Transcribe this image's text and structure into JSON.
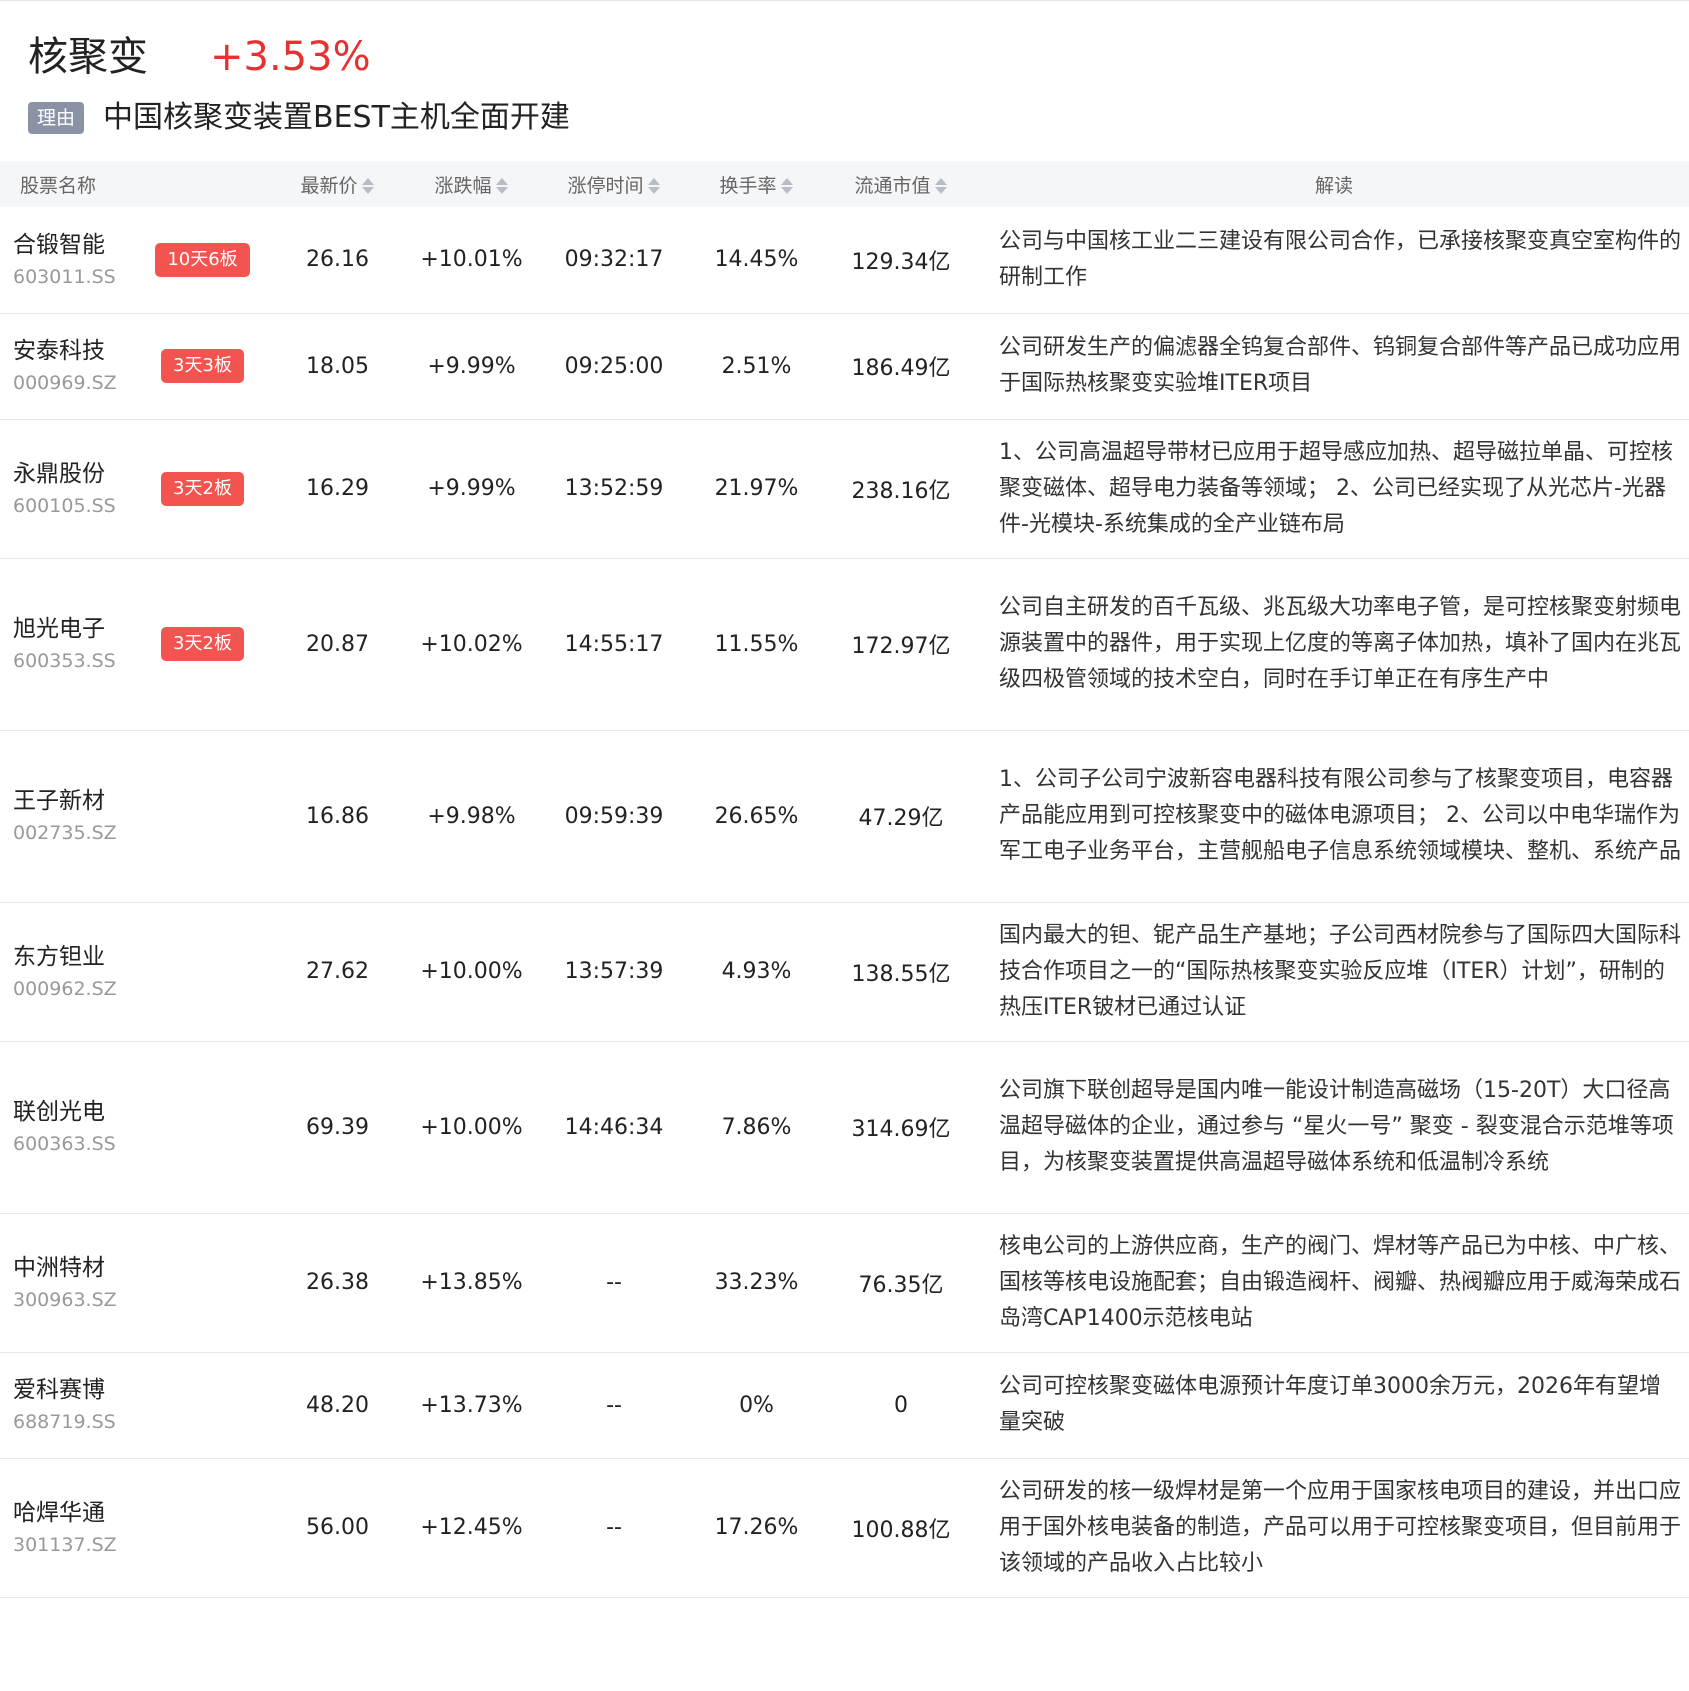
{
  "sector": {
    "name": "核聚变",
    "change": "+3.53%",
    "reason_tag": "理由",
    "reason_text": "中国核聚变装置BEST主机全面开建"
  },
  "table": {
    "headers": {
      "name": "股票名称",
      "price": "最新价",
      "change": "涨跌幅",
      "limit_time": "涨停时间",
      "turnover": "换手率",
      "market_cap": "流通市值",
      "note": "解读"
    },
    "rows": [
      {
        "name": "合锻智能",
        "code": "603011.SS",
        "badge": "10天6板",
        "price": "26.16",
        "change": "+10.01%",
        "limit_time": "09:32:17",
        "turnover": "14.45%",
        "market_cap": "129.34亿",
        "note": "公司与中国核工业二三建设有限公司合作，已承接核聚变真空室构件的研制工作"
      },
      {
        "name": "安泰科技",
        "code": "000969.SZ",
        "badge": "3天3板",
        "price": "18.05",
        "change": "+9.99%",
        "limit_time": "09:25:00",
        "turnover": "2.51%",
        "market_cap": "186.49亿",
        "note": "公司研发生产的偏滤器全钨复合部件、钨铜复合部件等产品已成功应用于国际热核聚变实验堆ITER项目"
      },
      {
        "name": "永鼎股份",
        "code": "600105.SS",
        "badge": "3天2板",
        "price": "16.29",
        "change": "+9.99%",
        "limit_time": "13:52:59",
        "turnover": "21.97%",
        "market_cap": "238.16亿",
        "note": "1、公司高温超导带材已应用于超导感应加热、超导磁拉单晶、可控核聚变磁体、超导电力装备等领域； 2、公司已经实现了从光芯片-光器件-光模块-系统集成的全产业链布局"
      },
      {
        "name": "旭光电子",
        "code": "600353.SS",
        "badge": "3天2板",
        "price": "20.87",
        "change": "+10.02%",
        "limit_time": "14:55:17",
        "turnover": "11.55%",
        "market_cap": "172.97亿",
        "note": "公司自主研发的百千瓦级、兆瓦级大功率电子管，是可控核聚变射频电源装置中的器件，用于实现上亿度的等离子体加热，填补了国内在兆瓦级四极管领域的技术空白，同时在手订单正在有序生产中"
      },
      {
        "name": "王子新材",
        "code": "002735.SZ",
        "badge": "",
        "price": "16.86",
        "change": "+9.98%",
        "limit_time": "09:59:39",
        "turnover": "26.65%",
        "market_cap": "47.29亿",
        "note": "1、公司子公司宁波新容电器科技有限公司参与了核聚变项目，电容器产品能应用到可控核聚变中的磁体电源项目； 2、公司以中电华瑞作为军工电子业务平台，主营舰船电子信息系统领域模块、整机、系统产品"
      },
      {
        "name": "东方钽业",
        "code": "000962.SZ",
        "badge": "",
        "price": "27.62",
        "change": "+10.00%",
        "limit_time": "13:57:39",
        "turnover": "4.93%",
        "market_cap": "138.55亿",
        "note": "国内最大的钽、铌产品生产基地；子公司西材院参与了国际四大国际科技合作项目之一的“国际热核聚变实验反应堆（ITER）计划”，研制的热压ITER铍材已通过认证"
      },
      {
        "name": "联创光电",
        "code": "600363.SS",
        "badge": "",
        "price": "69.39",
        "change": "+10.00%",
        "limit_time": "14:46:34",
        "turnover": "7.86%",
        "market_cap": "314.69亿",
        "note": "公司旗下联创超导是国内唯一能设计制造高磁场（15-20T）大口径高温超导磁体的企业，通过参与 “星火一号” 聚变 - 裂变混合示范堆等项目，为核聚变装置提供高温超导磁体系统和低温制冷系统"
      },
      {
        "name": "中洲特材",
        "code": "300963.SZ",
        "badge": "",
        "price": "26.38",
        "change": "+13.85%",
        "limit_time": "--",
        "turnover": "33.23%",
        "market_cap": "76.35亿",
        "note": "核电公司的上游供应商，生产的阀门、焊材等产品已为中核、中广核、国核等核电设施配套；自由锻造阀杆、阀瓣、热阀瓣应用于威海荣成石岛湾CAP1400示范核电站"
      },
      {
        "name": "爱科赛博",
        "code": "688719.SS",
        "badge": "",
        "price": "48.20",
        "change": "+13.73%",
        "limit_time": "--",
        "turnover": "0%",
        "market_cap": "0",
        "note": "公司可控核聚变磁体电源预计年度订单3000余万元，2026年有望增量突破"
      },
      {
        "name": "哈焊华通",
        "code": "301137.SZ",
        "badge": "",
        "price": "56.00",
        "change": "+12.45%",
        "limit_time": "--",
        "turnover": "17.26%",
        "market_cap": "100.88亿",
        "note": "公司研发的核一级焊材是第一个应用于国家核电项目的建设，并出口应用于国外核电装备的制造，产品可以用于可控核聚变项目，但目前用于该领域的产品收入占比较小"
      }
    ]
  }
}
